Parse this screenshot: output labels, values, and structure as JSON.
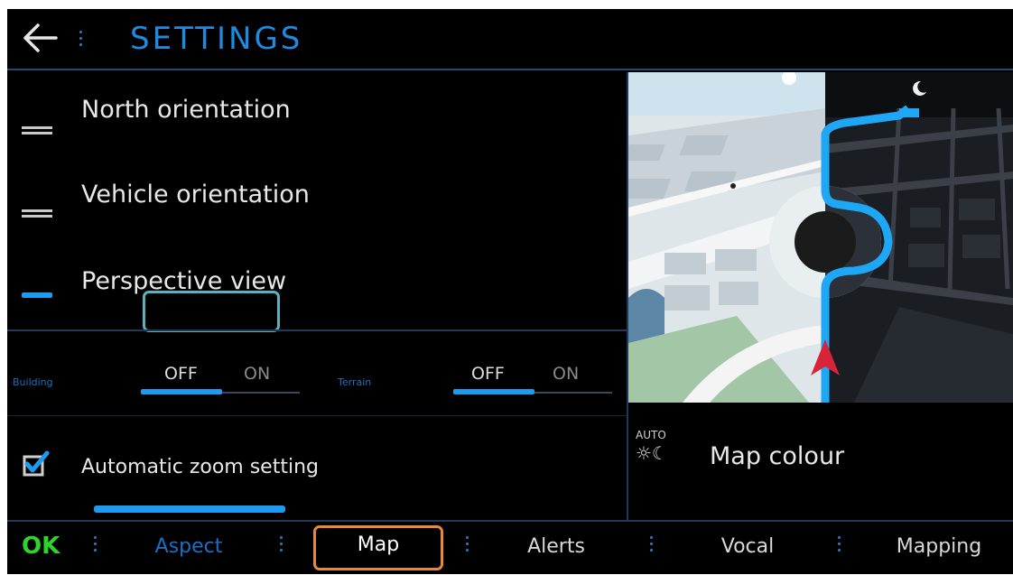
{
  "header": {
    "title": "SETTINGS"
  },
  "options": {
    "north": "North orientation",
    "vehicle": "Vehicle orientation",
    "perspective": "Perspective view"
  },
  "toggles": {
    "building": {
      "label": "Building",
      "off": "OFF",
      "on": "ON"
    },
    "terrain": {
      "label": "Terrain",
      "off": "OFF",
      "on": "ON"
    }
  },
  "zoom": {
    "label": "Automatic zoom setting",
    "checked": true
  },
  "map_colour": {
    "auto": "AUTO",
    "label": "Map colour"
  },
  "bottom": {
    "ok": "OK",
    "tabs": [
      "Aspect",
      "Map",
      "Alerts",
      "Vocal",
      "Mapping"
    ]
  },
  "colors": {
    "accent": "#1d9bf0",
    "title": "#1f8be0",
    "ok": "#2fd22f",
    "focus_teal": "#5fb0bf",
    "focus_orange": "#e58a3c",
    "route": "#1ea7f5",
    "arrow": "#d8243a"
  }
}
